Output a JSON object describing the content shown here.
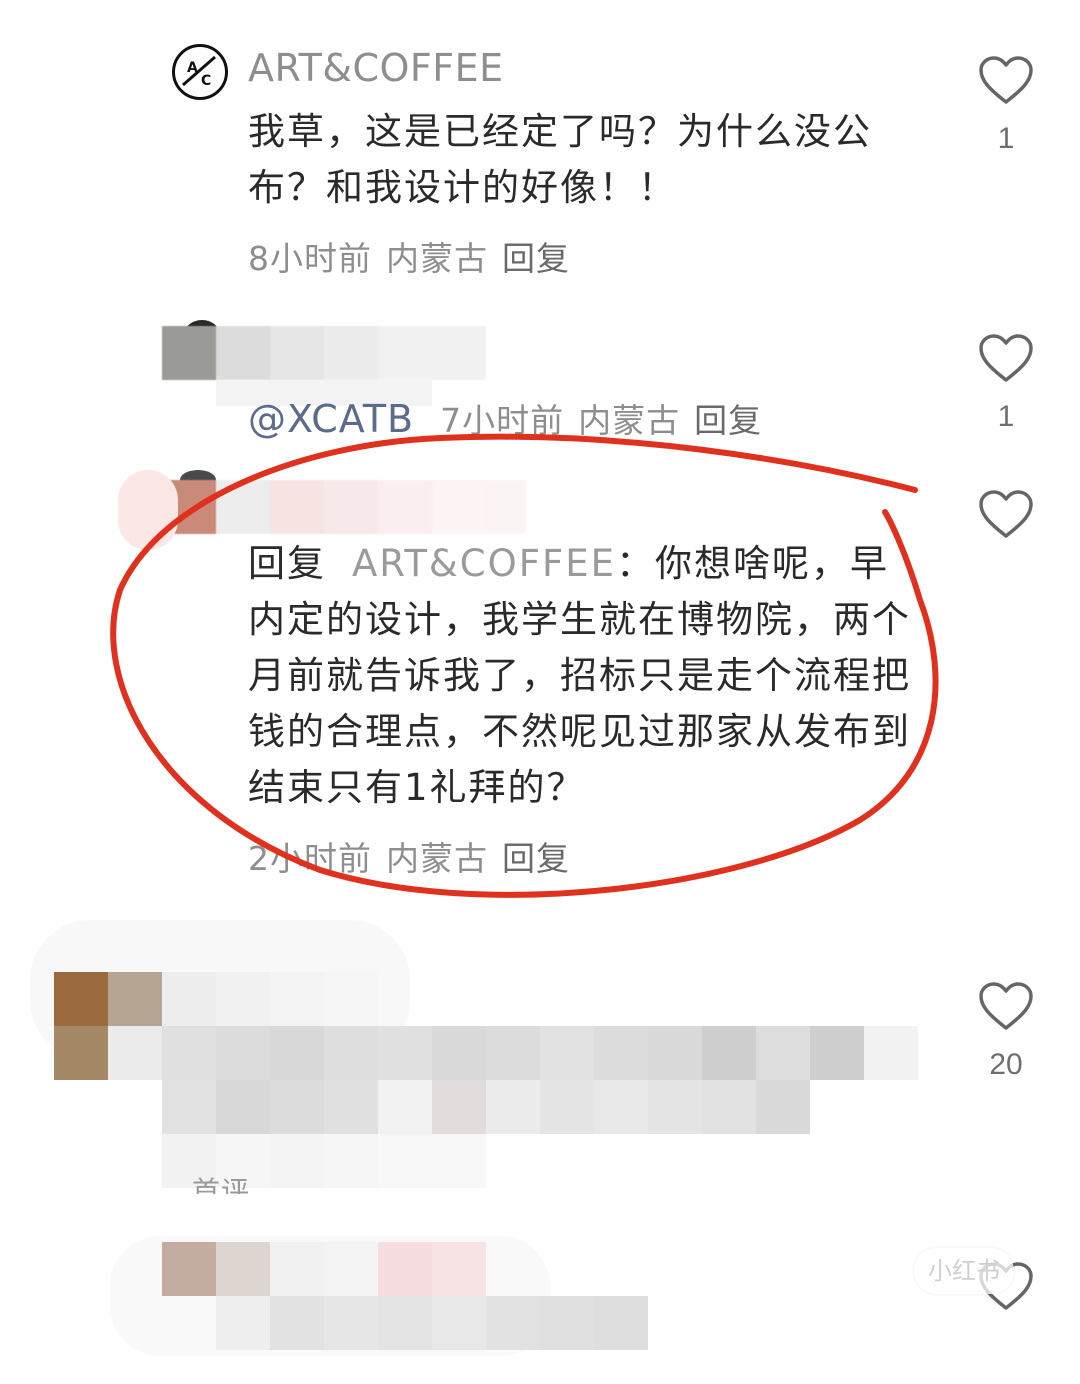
{
  "comment1": {
    "username": "ART&COFFEE",
    "text": "我草，这是已经定了吗？为什么没公布？和我设计的好像！！",
    "time": "8小时前",
    "location": "内蒙古",
    "reply": "回复",
    "likes": "1"
  },
  "comment2": {
    "mention": "@XCATB",
    "time": "7小时前",
    "location": "内蒙古",
    "reply": "回复",
    "likes": "1"
  },
  "comment3": {
    "reply_prefix": "回复",
    "quoted_user": "ART&COFFEE",
    "text": "：你想啥呢，早内定的设计，我学生就在博物院，两个月前就告诉我了，招标只是走个流程把钱的合理点，不然呢见过那家从发布到结束只有1礼拜的？",
    "time": "2小时前",
    "location": "内蒙古",
    "reply": "回复"
  },
  "comment4": {
    "likes": "20",
    "partial_text": "首评"
  },
  "watermark": "小红书",
  "colors": {
    "annotation_red": "#e0301e",
    "meta_gray": "#8e8e8e",
    "mention_blue": "#5a6b8c"
  },
  "icons": {
    "logo": "art-coffee-logo",
    "like": "heart-outline-icon"
  }
}
